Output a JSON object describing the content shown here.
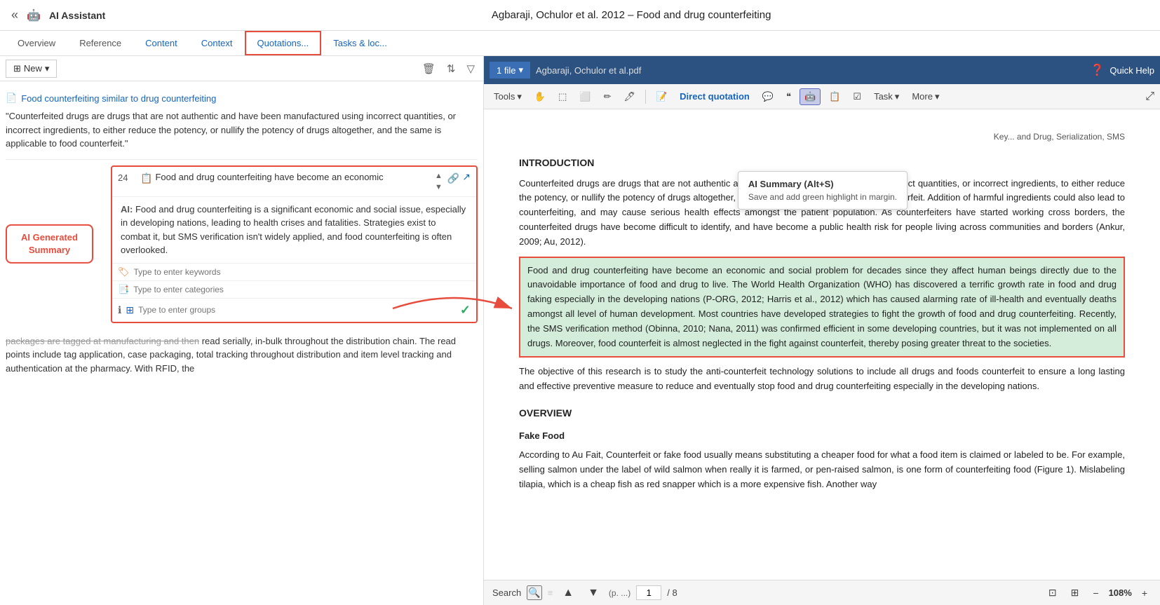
{
  "titleBar": {
    "backLabel": "«",
    "aiIconLabel": "🤖",
    "aiLabel": "AI Assistant",
    "docTitle": "Agbaraji, Ochulor et al. 2012 – Food and drug counterfeiting"
  },
  "tabs": [
    {
      "id": "overview",
      "label": "Overview",
      "active": false
    },
    {
      "id": "reference",
      "label": "Reference",
      "active": false
    },
    {
      "id": "content",
      "label": "Content",
      "active": false
    },
    {
      "id": "context",
      "label": "Context",
      "active": false
    },
    {
      "id": "quotations",
      "label": "Quotations...",
      "active": true
    },
    {
      "id": "tasks",
      "label": "Tasks & loc...",
      "active": false
    }
  ],
  "leftPanel": {
    "toolbar": {
      "newLabel": "New",
      "newDropdown": "▾"
    },
    "topQuote": {
      "sourceLabel": "Food counterfeiting similar to drug counterfeiting",
      "text": "\"Counterfeited drugs are drugs that are not authentic and have been manufactured using incorrect quantities, or incorrect ingredients, to either reduce the potency, or nullify the potency of drugs altogether, and the same is applicable to food counterfeit.\""
    },
    "mainCard": {
      "number": "24",
      "titleText": "Food and drug counterfeiting have become an economic",
      "aiSummaryLabel": "AI:",
      "aiSummaryText": "Food and drug counterfeiting is a significant economic and social issue, especially in developing nations, leading to health crises and fatalities. Strategies exist to combat it, but SMS verification isn't widely applied, and food counterfeiting is often overlooked.",
      "keywordsPlaceholder": "Type to enter keywords",
      "categoriesPlaceholder": "Type to enter categories",
      "groupsPlaceholder": "Type to enter groups"
    },
    "aiGeneratedLabel": "AI Generated\nSummary",
    "bottomQuote": {
      "strikeText": "packages are tagged at manufacturing and then",
      "text": "read serially, in-bulk throughout the distribution chain. The read points include tag application, case packaging, total tracking throughout distribution and item level tracking and authentication at the pharmacy. With RFID, the"
    }
  },
  "rightPanel": {
    "toolbar": {
      "fileLabel": "1 file",
      "fileDropdown": "▾",
      "filename": "Agbaraji, Ochulor et al.pdf",
      "quickHelpLabel": "Quick Help",
      "toolsLabel": "Tools",
      "directQuotationLabel": "Direct quotation",
      "taskLabel": "Task",
      "taskDropdown": "▾",
      "moreLabel": "More",
      "moreDropdown": "▾"
    },
    "tooltip": {
      "title": "AI Summary (Alt+S)",
      "description": "Save and add green highlight in margin."
    },
    "pdfContent": {
      "headerLine": "Key... and Drug, Serialization, SMS",
      "intro": {
        "title": "INTRODUCTION",
        "para1": "Counterfeited drugs are drugs that are not authentic and have been manufactured using incorrect quantities, or incorrect ingredients, to either reduce the potency, or nullify the potency of drugs altogether, and the same is applicable to food counterfeit. Addition of harmful ingredients could also lead to counterfeiting, and may cause serious health effects amongst the patient population. As counterfeiters have started working cross borders, the counterfeited drugs have become difficult to identify, and have become a public health risk for people living across communities and borders (Ankur, 2009; Au, 2012).",
        "highlightedPara": "Food and drug counterfeiting have become an economic and social problem for decades since they affect human beings directly due to the unavoidable importance of food and drug to live. The World Health Organization (WHO) has discovered a terrific growth rate in food and drug faking especially in the developing nations (P-ORG, 2012; Harris et al., 2012) which has caused alarming rate of ill-health and eventually deaths amongst all level of human development. Most countries have developed strategies to fight the growth of food and drug counterfeiting. Recently, the SMS verification method (Obinna, 2010; Nana, 2011) was confirmed efficient in some developing countries, but it was not implemented on all drugs. Moreover, food counterfeit is almost neglected in the fight against counterfeit, thereby posing greater threat to the societies.",
        "para2": "The objective of this research is to study the anti-counterfeit technology solutions to include all drugs and foods counterfeit to ensure a long lasting and effective preventive measure to reduce and eventually stop food and drug counterfeiting especially in the developing nations."
      },
      "overview": {
        "title": "OVERVIEW",
        "fakeFood": {
          "subtitle": "Fake Food",
          "para": "According to Au Fait, Counterfeit or fake food usually means substituting a cheaper food for what a food item is claimed or labeled to be. For example, selling salmon under the label of wild salmon when really it is farmed, or pen-raised salmon, is one form of counterfeiting food (Figure 1). Mislabeling tilapia, which is a cheap fish as red snapper which is a more expensive fish. Another way"
        }
      }
    },
    "bottomBar": {
      "searchLabel": "Search",
      "pageNum": "1",
      "pageTotal": "/ 8",
      "zoomLevel": "108%"
    }
  }
}
